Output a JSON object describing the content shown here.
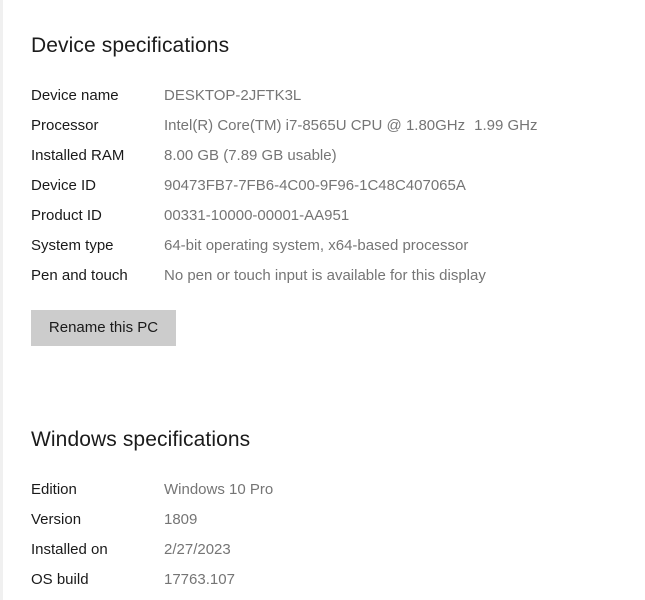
{
  "page": {
    "background_color": "#ffffff",
    "label_color": "#1a1a1a",
    "value_color": "#757575",
    "heading_color": "#1b1b1b",
    "button_color": "#cccccc"
  },
  "device_specifications": {
    "title": "Device specifications",
    "rows": [
      {
        "label": "Device name",
        "value": "DESKTOP-2JFTK3L"
      },
      {
        "label": "Processor",
        "value": "Intel(R) Core(TM) i7-8565U CPU @ 1.80GHz"
      },
      {
        "label": "Installed RAM",
        "value": "8.00 GB (7.89 GB usable)"
      },
      {
        "label": "Device ID",
        "value": "90473FB7-7FB6-4C00-9F96-1C48C407065A"
      },
      {
        "label": "Product ID",
        "value": "00331-10000-00001-AA951"
      },
      {
        "label": "System type",
        "value": "64-bit operating system, x64-based processor"
      },
      {
        "label": "Pen and touch",
        "value": "No pen or touch input is available for this display"
      }
    ],
    "processor_clock_speed": "1.99 GHz",
    "rename_button_label": "Rename this PC"
  },
  "windows_specifications": {
    "title": "Windows specifications",
    "rows": [
      {
        "label": "Edition",
        "value": "Windows 10 Pro"
      },
      {
        "label": "Version",
        "value": "1809"
      },
      {
        "label": "Installed on",
        "value": "2/27/2023"
      },
      {
        "label": "OS build",
        "value": "17763.107"
      }
    ]
  }
}
